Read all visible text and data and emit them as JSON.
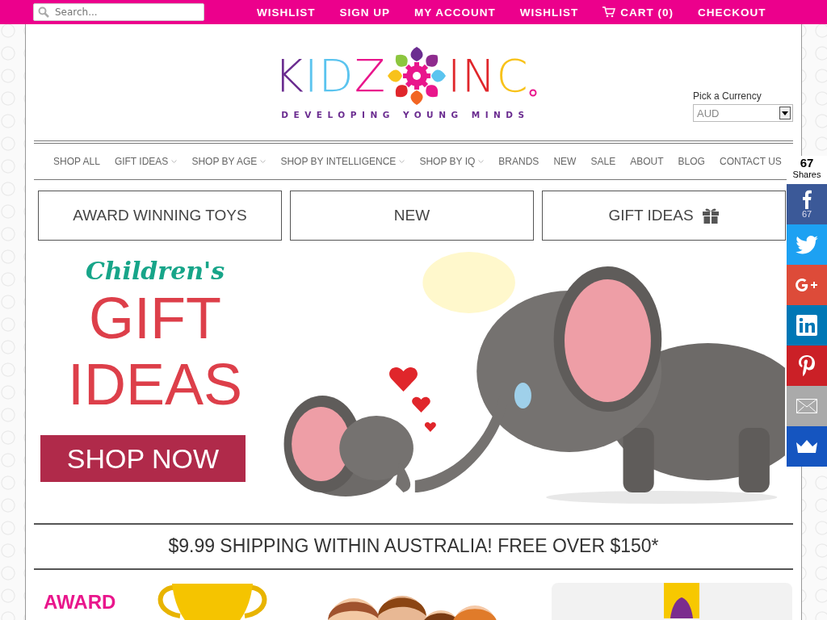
{
  "search": {
    "placeholder": "Search..."
  },
  "top_links": [
    {
      "label": "WISHLIST",
      "kind": "text"
    },
    {
      "label": "SIGN UP",
      "kind": "text"
    },
    {
      "label": "MY ACCOUNT",
      "kind": "text"
    },
    {
      "label": "WISHLIST",
      "kind": "text"
    },
    {
      "label": "CART (0)",
      "kind": "cart"
    },
    {
      "label": "CHECKOUT",
      "kind": "text"
    }
  ],
  "logo": {
    "word_1": "KIDZ",
    "word_2": "INC",
    "tagline": "DEVELOPING YOUNG MINDS"
  },
  "currency": {
    "label": "Pick a Currency",
    "value": "AUD"
  },
  "nav": [
    {
      "label": "SHOP ALL",
      "dropdown": false
    },
    {
      "label": "GIFT IDEAS",
      "dropdown": true
    },
    {
      "label": "SHOP BY AGE",
      "dropdown": true
    },
    {
      "label": "SHOP BY INTELLIGENCE",
      "dropdown": true
    },
    {
      "label": "SHOP BY IQ",
      "dropdown": true
    },
    {
      "label": "BRANDS",
      "dropdown": false
    },
    {
      "label": "NEW",
      "dropdown": false
    },
    {
      "label": "SALE",
      "dropdown": false
    },
    {
      "label": "ABOUT",
      "dropdown": false
    },
    {
      "label": "BLOG",
      "dropdown": false
    },
    {
      "label": "CONTACT US",
      "dropdown": false
    }
  ],
  "promo_boxes": [
    {
      "label": "AWARD WINNING TOYS",
      "kind": "plain"
    },
    {
      "label": "NEW",
      "kind": "plain"
    },
    {
      "label": "GIFT IDEAS",
      "kind": "gift"
    }
  ],
  "banner": {
    "script": "Children's",
    "title_1": "GIFT",
    "title_2": "IDEAS",
    "button": "SHOP NOW"
  },
  "shipping": "$9.99 SHIPPING WITHIN AUSTRALIA! FREE OVER $150*",
  "share": {
    "count": "67",
    "label": "Shares",
    "buttons": [
      {
        "kind": "facebook",
        "count": "67"
      },
      {
        "kind": "twitter"
      },
      {
        "kind": "googleplus"
      },
      {
        "kind": "linkedin"
      },
      {
        "kind": "pinterest"
      },
      {
        "kind": "email"
      },
      {
        "kind": "sumome"
      }
    ]
  },
  "bottom_row": {
    "award_title": "AWARD"
  }
}
